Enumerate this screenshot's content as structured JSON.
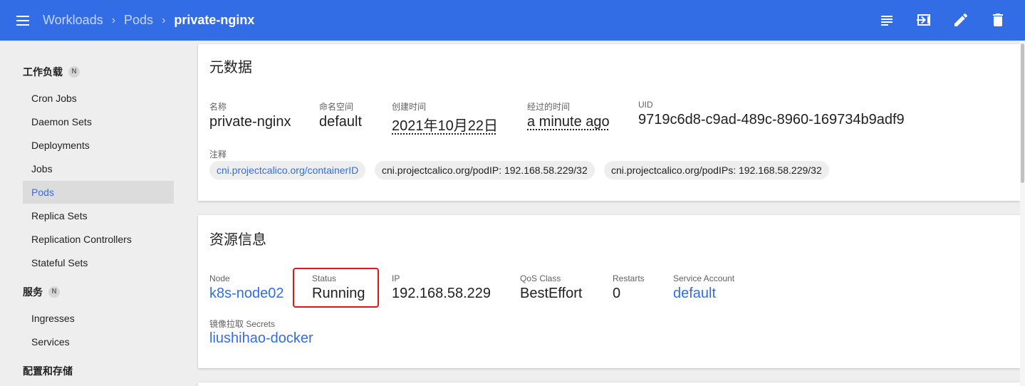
{
  "header": {
    "breadcrumbs": [
      "Workloads",
      "Pods"
    ],
    "current": "private-nginx",
    "actions": [
      "logs-icon",
      "exec-icon",
      "edit-icon",
      "delete-icon"
    ],
    "color": "#326de6"
  },
  "sidebar": {
    "categories": [
      {
        "label": "工作负载",
        "badge": "N"
      },
      {
        "label": "服务",
        "badge": "N"
      },
      {
        "label": "配置和存储"
      }
    ],
    "workloads": [
      "Cron Jobs",
      "Daemon Sets",
      "Deployments",
      "Jobs",
      "Pods",
      "Replica Sets",
      "Replication Controllers",
      "Stateful Sets"
    ],
    "services": [
      "Ingresses",
      "Services"
    ],
    "active": "Pods"
  },
  "metadata": {
    "title": "元数据",
    "name_label": "名称",
    "name": "private-nginx",
    "namespace_label": "命名空间",
    "namespace": "default",
    "created_label": "创建时间",
    "created": "2021年10月22日",
    "age_label": "经过的时间",
    "age": "a minute ago",
    "uid_label": "UID",
    "uid": "9719c6d8-c9ad-489c-8960-169734b9adf9",
    "annotations_label": "注释",
    "annotations": [
      "cni.projectcalico.org/containerID",
      "cni.projectcalico.org/podIP: 192.168.58.229/32",
      "cni.projectcalico.org/podIPs: 192.168.58.229/32"
    ]
  },
  "resource": {
    "title": "资源信息",
    "node_label": "Node",
    "node": "k8s-node02",
    "status_label": "Status",
    "status": "Running",
    "ip_label": "IP",
    "ip": "192.168.58.229",
    "qos_label": "QoS Class",
    "qos": "BestEffort",
    "restarts_label": "Restarts",
    "restarts": "0",
    "sa_label": "Service Account",
    "sa": "default",
    "secrets_label": "镜像拉取 Secrets",
    "secrets": "liushihao-docker",
    "highlight_color": "#e01717"
  }
}
